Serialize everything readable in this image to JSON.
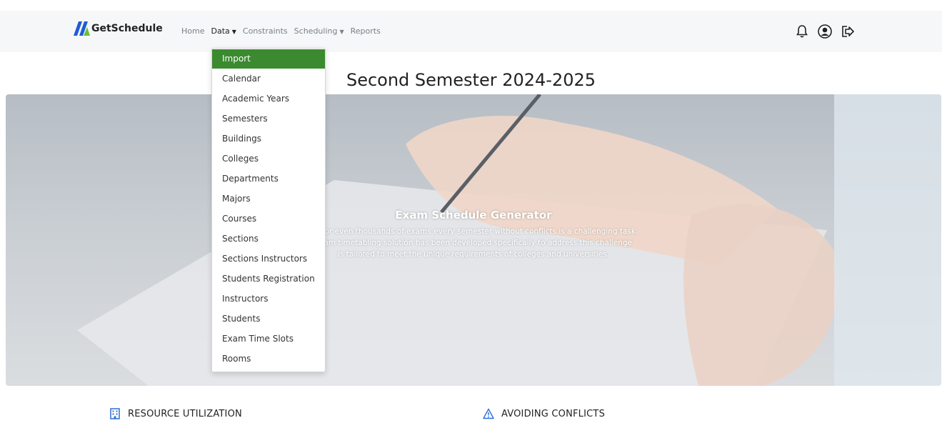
{
  "nav": {
    "brand": "GetSchedule",
    "links": [
      {
        "label": "Home"
      },
      {
        "label": "Data",
        "has_caret": true,
        "active": true
      },
      {
        "label": "Constraints"
      },
      {
        "label": "Scheduling",
        "has_caret": true
      },
      {
        "label": "Reports"
      }
    ],
    "icons": [
      "bell-icon",
      "user-circle-icon",
      "logout-icon"
    ]
  },
  "dropdown": {
    "items": [
      "Import",
      "Calendar",
      "Academic Years",
      "Semesters",
      "Buildings",
      "Colleges",
      "Departments",
      "Majors",
      "Courses",
      "Sections",
      "Sections Instructors",
      "Students Registration",
      "Instructors",
      "Students",
      "Exam Time Slots",
      "Rooms"
    ],
    "selected": "Import"
  },
  "page": {
    "title": "Second Semester 2024-2025"
  },
  "hero": {
    "heading": "Exam Schedule Generator",
    "lines": [
      "eds or even thousands of exams every semester without conflicts is a challenging task.",
      "exam timetabling solution has been developed specifically to address this challenge",
      "is tailored to meet the unique requirements of colleges and universities."
    ]
  },
  "features": [
    {
      "icon": "building-icon",
      "label": "RESOURCE UTILIZATION"
    },
    {
      "icon": "warning-icon",
      "label": "AVOIDING CONFLICTS"
    }
  ],
  "colors": {
    "accent": "#3b8a2f",
    "brand_blue": "#1e5bd8",
    "brand_green": "#6bbf3a",
    "nav_bg": "#f6f7f9"
  }
}
